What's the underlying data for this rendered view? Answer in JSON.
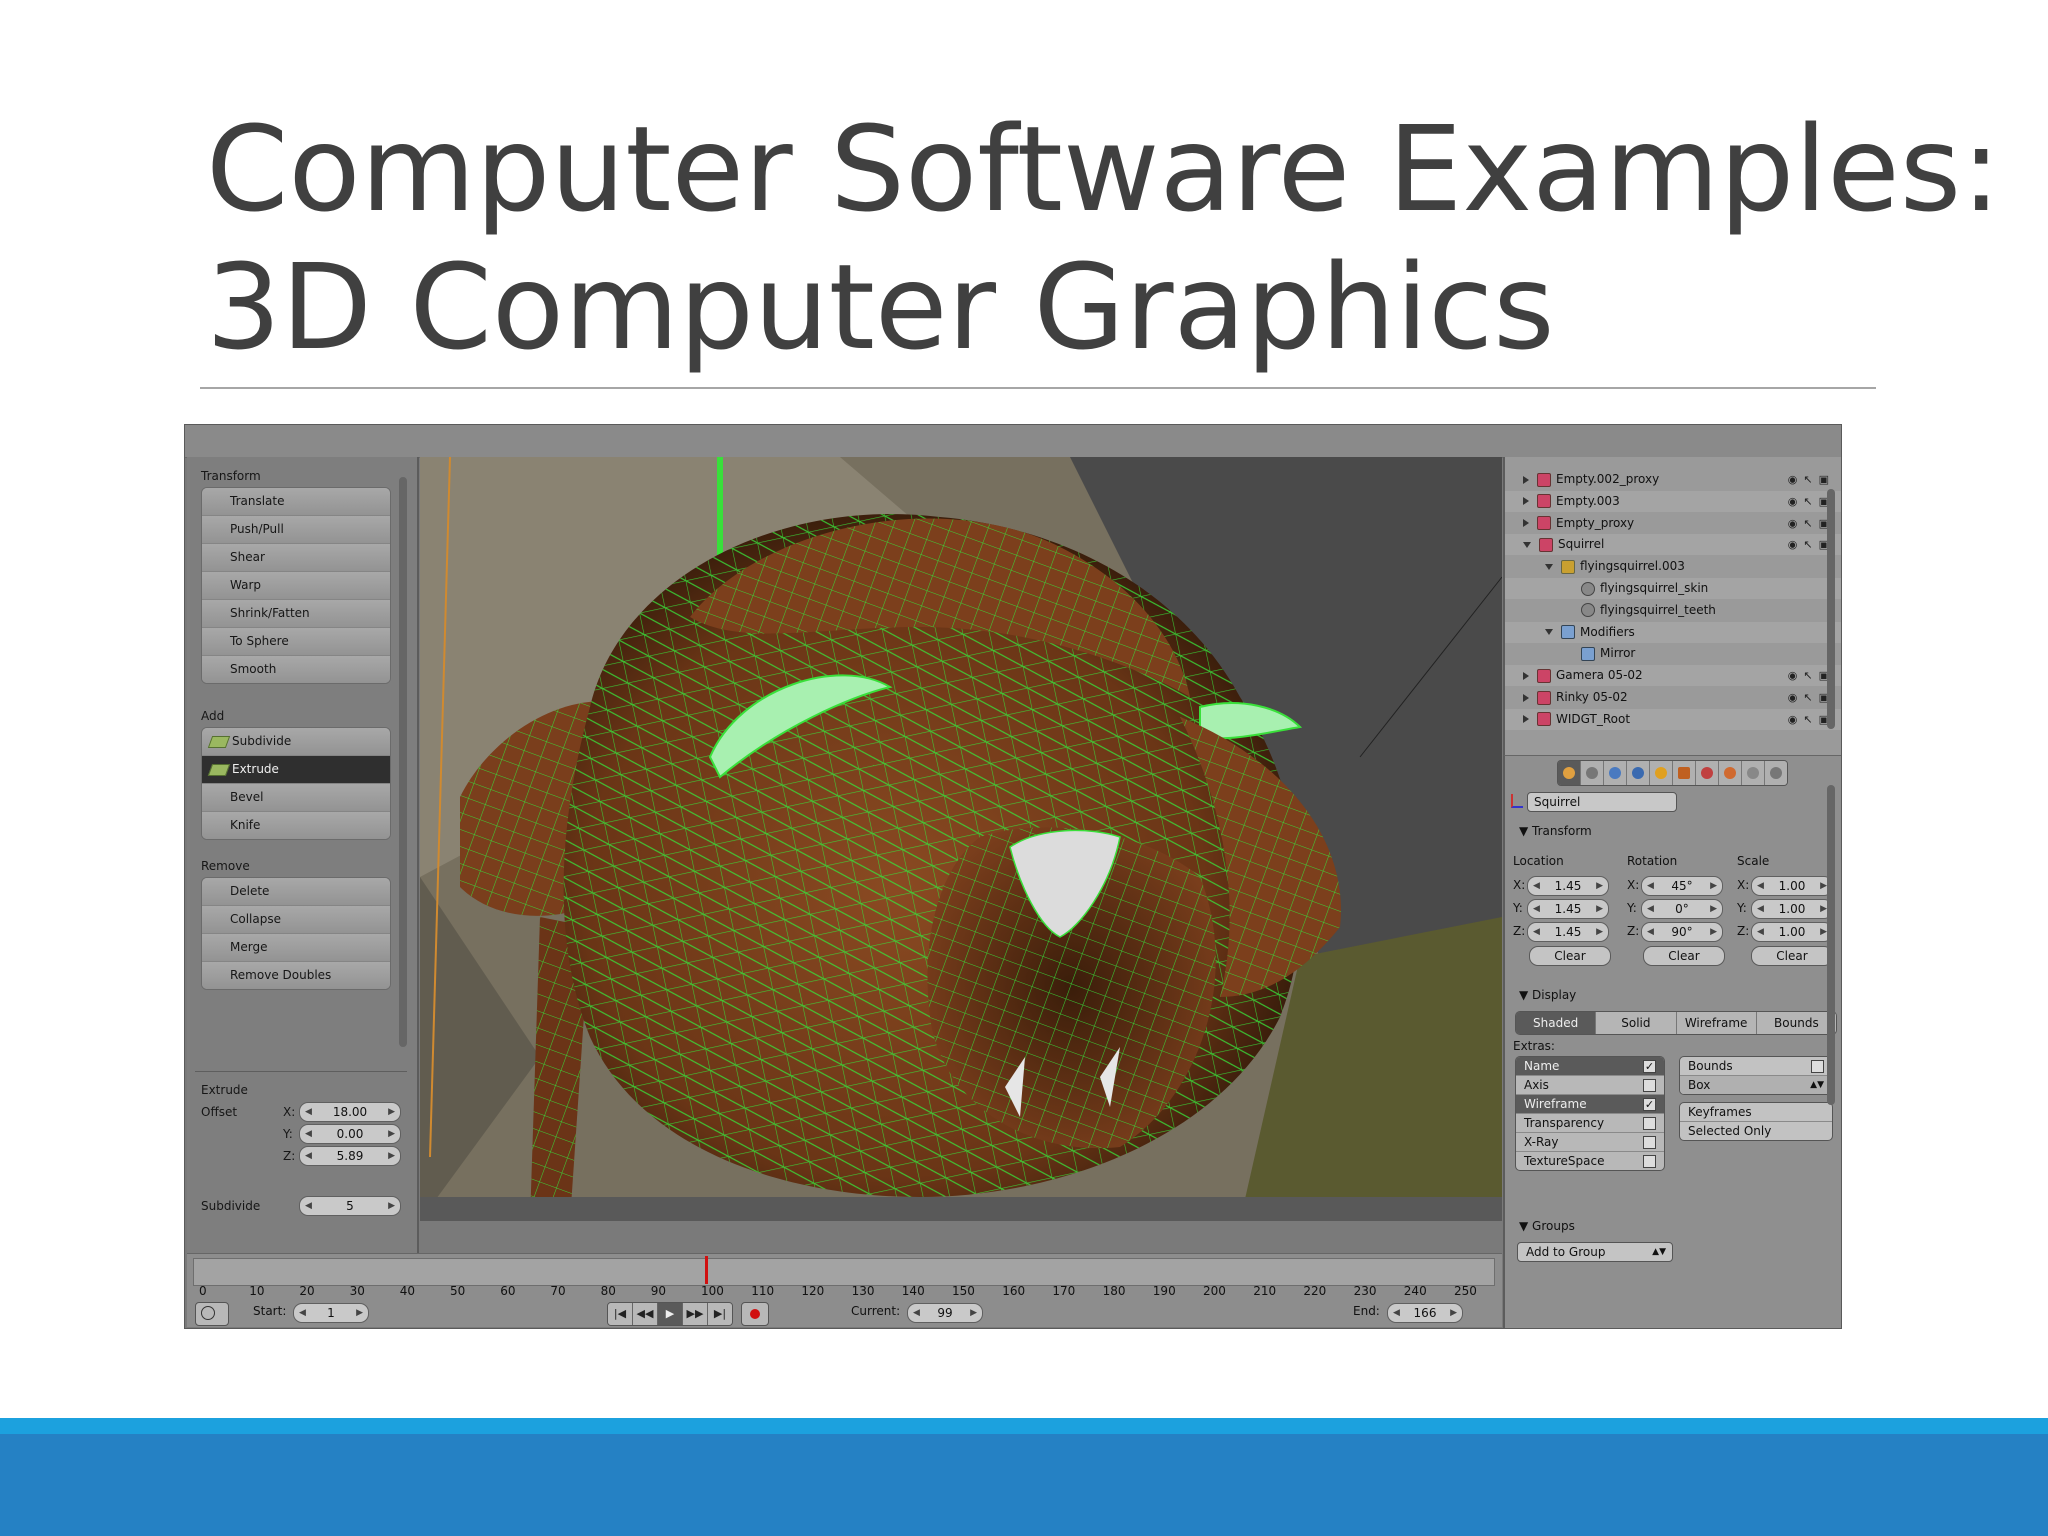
{
  "slide": {
    "title_line1": "Computer Software Examples:",
    "title_line2": "3D Computer Graphics"
  },
  "tool_panel": {
    "transform": {
      "label": "Transform",
      "buttons": [
        "Translate",
        "Push/Pull",
        "Shear",
        "Warp",
        "Shrink/Fatten",
        "To Sphere",
        "Smooth"
      ]
    },
    "add": {
      "label": "Add",
      "buttons": [
        "Subdivide",
        "Extrude",
        "Bevel",
        "Knife"
      ],
      "active": "Extrude"
    },
    "remove": {
      "label": "Remove",
      "buttons": [
        "Delete",
        "Collapse",
        "Merge",
        "Remove Doubles"
      ]
    },
    "extrude": {
      "label": "Extrude",
      "offset_label": "Offset",
      "x_label": "X:",
      "x": "18.00",
      "y_label": "Y:",
      "y": "0.00",
      "z_label": "Z:",
      "z": "5.89",
      "subdivide_label": "Subdivide",
      "subdivide": "5"
    }
  },
  "timeline": {
    "ticks": [
      "0",
      "10",
      "20",
      "30",
      "40",
      "50",
      "60",
      "70",
      "80",
      "90",
      "100",
      "110",
      "120",
      "130",
      "140",
      "150",
      "160",
      "170",
      "180",
      "190",
      "200",
      "210",
      "220",
      "230",
      "240",
      "250"
    ],
    "start_label": "Start:",
    "start": "1",
    "current_label": "Current:",
    "current": "99",
    "end_label": "End:",
    "end": "166"
  },
  "outliner": {
    "rows": [
      {
        "name": "Empty.002_proxy",
        "indent": 0
      },
      {
        "name": "Empty.003",
        "indent": 0
      },
      {
        "name": "Empty_proxy",
        "indent": 0
      },
      {
        "name": "Squirrel",
        "indent": 0
      },
      {
        "name": "flyingsquirrel.003",
        "indent": 1
      },
      {
        "name": "flyingsquirrel_skin",
        "indent": 2
      },
      {
        "name": "flyingsquirrel_teeth",
        "indent": 2
      },
      {
        "name": "Modifiers",
        "indent": 1
      },
      {
        "name": "Mirror",
        "indent": 2
      },
      {
        "name": "Gamera 05-02",
        "indent": 0
      },
      {
        "name": "Rinky 05-02",
        "indent": 0
      },
      {
        "name": "WIDGT_Root",
        "indent": 0
      }
    ]
  },
  "properties": {
    "object_name": "Squirrel",
    "transform_label": "Transform",
    "location_label": "Location",
    "rotation_label": "Rotation",
    "scale_label": "Scale",
    "location": {
      "x": "1.45",
      "y": "1.45",
      "z": "1.45"
    },
    "rotation": {
      "x": "45°",
      "y": "0°",
      "z": "90°"
    },
    "scale": {
      "x": "1.00",
      "y": "1.00",
      "z": "1.00"
    },
    "axis_x": "X:",
    "axis_y": "Y:",
    "axis_z": "Z:",
    "clear_label": "Clear",
    "display_label": "Display",
    "display_modes": [
      "Shaded",
      "Solid",
      "Wireframe",
      "Bounds"
    ],
    "display_active": "Shaded",
    "extras_label": "Extras:",
    "extras": [
      {
        "label": "Name",
        "checked": true
      },
      {
        "label": "Axis",
        "checked": false
      },
      {
        "label": "Wireframe",
        "checked": true
      },
      {
        "label": "Transparency",
        "checked": false
      },
      {
        "label": "X-Ray",
        "checked": false
      },
      {
        "label": "TextureSpace",
        "checked": false
      }
    ],
    "bounds_label": "Bounds",
    "bounds_type": "Box",
    "keyframes_label": "Keyframes",
    "selected_only_label": "Selected Only",
    "groups_label": "Groups",
    "add_to_group_label": "Add to Group"
  },
  "colors": {
    "footer_band": "#2581c4",
    "footer_stripe": "#1ca1de",
    "wireframe": "#39e03a",
    "mesh": "#7a3e1c"
  }
}
